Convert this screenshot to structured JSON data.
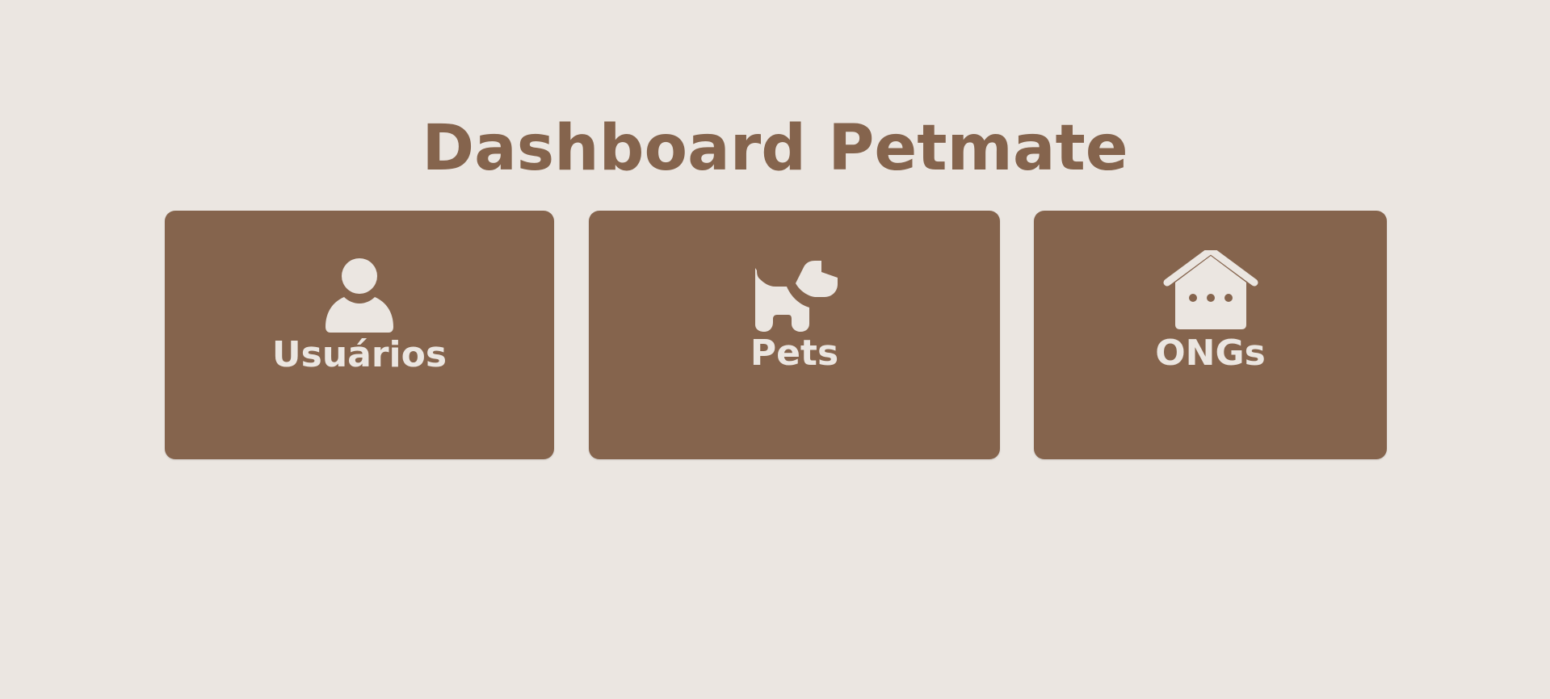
{
  "page": {
    "title": "Dashboard Petmate"
  },
  "colors": {
    "background": "#ebe6e1",
    "accent": "#85644d",
    "card_text": "#ebe6e1"
  },
  "cards": [
    {
      "label": "Usuários",
      "icon": "user-icon"
    },
    {
      "label": "Pets",
      "icon": "dog-icon"
    },
    {
      "label": "ONGs",
      "icon": "house-icon"
    }
  ]
}
